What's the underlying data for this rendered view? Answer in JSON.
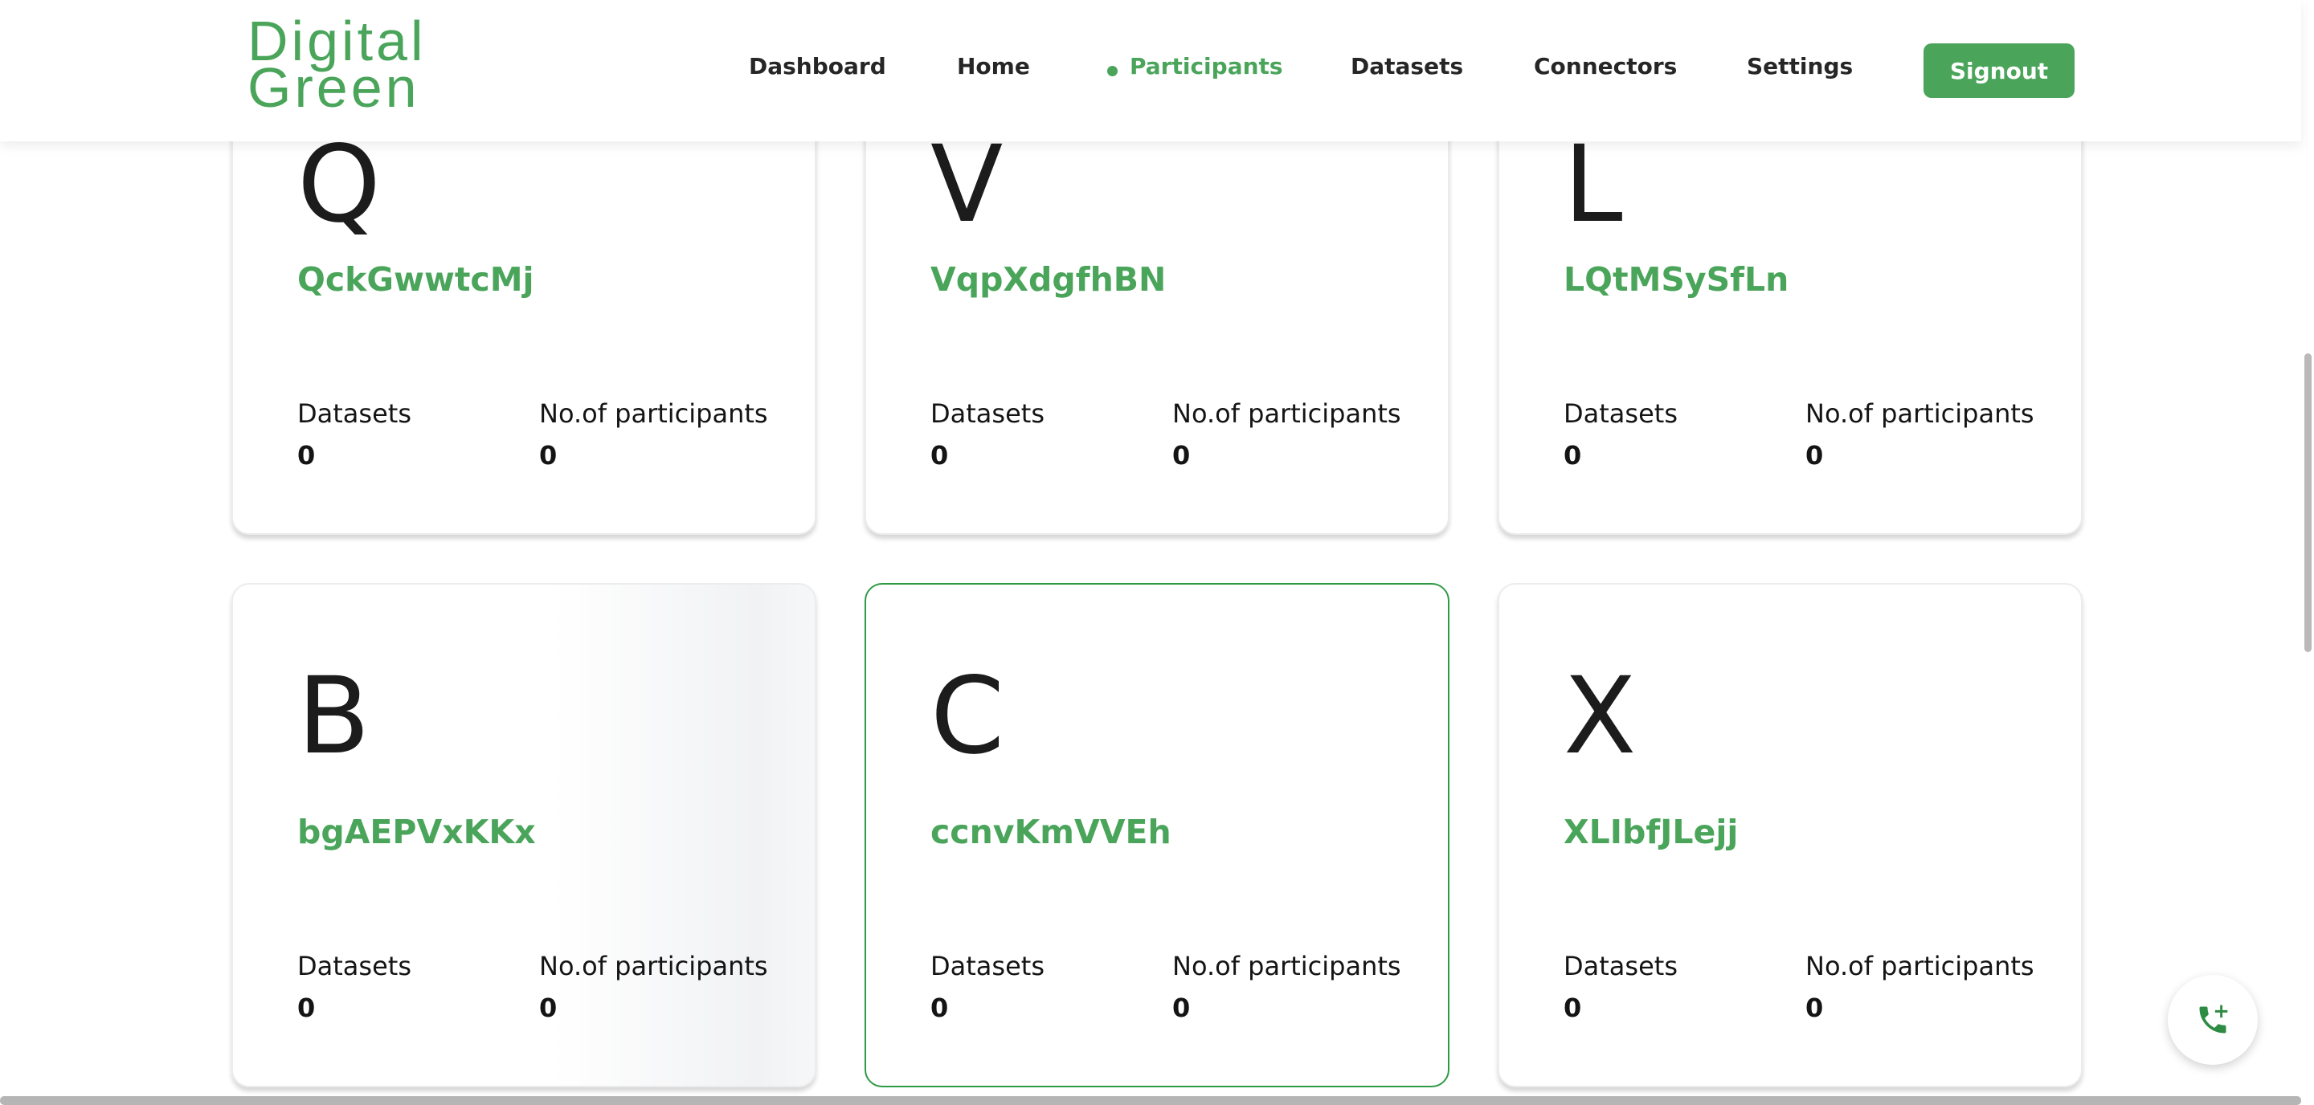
{
  "brand": {
    "line1": "Digital",
    "line2": "Green"
  },
  "nav": {
    "items": [
      {
        "label": "Dashboard"
      },
      {
        "label": "Home"
      },
      {
        "label": "Participants"
      },
      {
        "label": "Datasets"
      },
      {
        "label": "Connectors"
      },
      {
        "label": "Settings"
      }
    ],
    "active": "Participants",
    "signout_label": "Signout"
  },
  "cards": [
    {
      "initial": "Q",
      "name": "QckGwwtcMj",
      "datasets_label": "Datasets",
      "datasets_value": "0",
      "participants_label": "No.of participants",
      "participants_value": "0"
    },
    {
      "initial": "V",
      "name": "VqpXdgfhBN",
      "datasets_label": "Datasets",
      "datasets_value": "0",
      "participants_label": "No.of participants",
      "participants_value": "0"
    },
    {
      "initial": "L",
      "name": "LQtMSySfLn",
      "datasets_label": "Datasets",
      "datasets_value": "0",
      "participants_label": "No.of participants",
      "participants_value": "0"
    },
    {
      "initial": "B",
      "name": "bgAEPVxKKx",
      "datasets_label": "Datasets",
      "datasets_value": "0",
      "participants_label": "No.of participants",
      "participants_value": "0"
    },
    {
      "initial": "C",
      "name": "ccnvKmVVEh",
      "datasets_label": "Datasets",
      "datasets_value": "0",
      "participants_label": "No.of participants",
      "participants_value": "0"
    },
    {
      "initial": "X",
      "name": "XLIbfJLejj",
      "datasets_label": "Datasets",
      "datasets_value": "0",
      "participants_label": "No.of participants",
      "participants_value": "0"
    }
  ],
  "fab": {
    "icon": "phone-add-icon"
  },
  "colors": {
    "brand_green": "#4aa55b",
    "selected_border": "#2f9a45",
    "text": "#141414"
  }
}
